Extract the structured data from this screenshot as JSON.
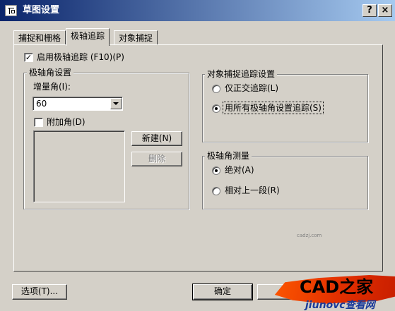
{
  "window": {
    "title": "草图设置",
    "help_button": "?",
    "close_button": "×"
  },
  "tabs": [
    {
      "label": "捕捉和栅格",
      "active": false
    },
    {
      "label": "极轴追踪",
      "active": true
    },
    {
      "label": "对象捕捉",
      "active": false
    }
  ],
  "enable_polar": {
    "label": "启用极轴追踪 (F10)(P)",
    "checked": true,
    "check_glyph": "✓"
  },
  "angle_settings": {
    "group_title": "极轴角设置",
    "increment_label": "增量角(I):",
    "increment_value": "60",
    "additional_label": "附加角(D)",
    "additional_checked": false,
    "new_button": "新建(N)",
    "delete_button": "删除"
  },
  "object_snap_tracking": {
    "group_title": "对象捕捉追踪设置",
    "options": [
      {
        "label": "仅正交追踪(L)",
        "selected": false
      },
      {
        "label": "用所有极轴角设置追踪(S)",
        "selected": true
      }
    ]
  },
  "polar_measurement": {
    "group_title": "极轴角测量",
    "options": [
      {
        "label": "绝对(A)",
        "selected": true
      },
      {
        "label": "相对上一段(R)",
        "selected": false
      }
    ]
  },
  "footer": {
    "options_button": "选项(T)...",
    "ok_button": "确定"
  },
  "watermark": {
    "brand": "CAD之家",
    "sub": "jiunovc查看网",
    "url": "cadzj.com",
    "brush_color": "#e33000"
  }
}
